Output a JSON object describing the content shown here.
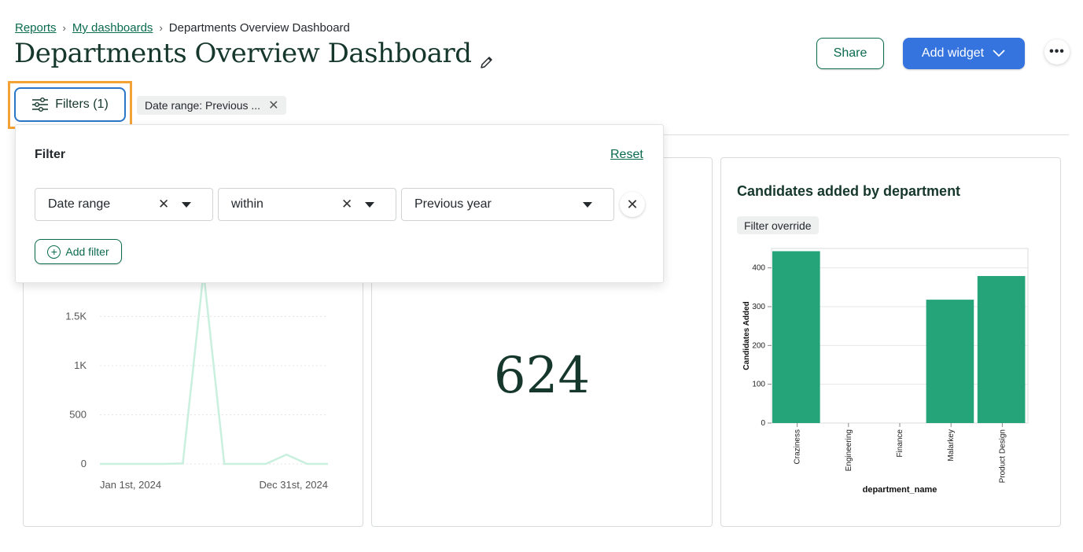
{
  "breadcrumb": {
    "items": [
      "Reports",
      "My dashboards"
    ],
    "current": "Departments Overview Dashboard"
  },
  "page": {
    "title": "Departments Overview Dashboard"
  },
  "header": {
    "share_label": "Share",
    "add_widget_label": "Add widget",
    "more_label": "•••"
  },
  "filters": {
    "button_label": "Filters (1)",
    "active_chip": "Date range: Previous ..."
  },
  "popover": {
    "title": "Filter",
    "reset_label": "Reset",
    "field": "Date range",
    "operator": "within",
    "value": "Previous year",
    "add_filter_label": "Add filter"
  },
  "widgets": {
    "count_value": "624",
    "bar_title": "Candidates added by department",
    "bar_override_label": "Filter override"
  },
  "chart_data": [
    {
      "type": "line",
      "x": [
        "Jan 1st, 2024",
        "",
        "",
        "",
        "",
        "",
        "",
        "",
        "",
        "",
        "",
        "Dec 31st, 2024"
      ],
      "x_tick_labels": [
        "Jan 1st, 2024",
        "Dec 31st, 2024"
      ],
      "y_ticks": [
        "0",
        "500",
        "1K",
        "1.5K"
      ],
      "values": [
        0,
        0,
        0,
        0,
        5,
        1950,
        0,
        0,
        0,
        95,
        0,
        0
      ],
      "ylim": [
        0,
        2000
      ],
      "color": "#c9efdf"
    },
    {
      "type": "bar",
      "categories": [
        "Craziness",
        "Engineering",
        "Finance",
        "Malarkey",
        "Product Design"
      ],
      "values": [
        443,
        0,
        0,
        318,
        379
      ],
      "ylabel": "Candidates Added",
      "xlabel": "department_name",
      "y_ticks": [
        "0",
        "100",
        "200",
        "300",
        "400"
      ],
      "ylim": [
        0,
        450
      ],
      "color": "#25a47a"
    }
  ]
}
